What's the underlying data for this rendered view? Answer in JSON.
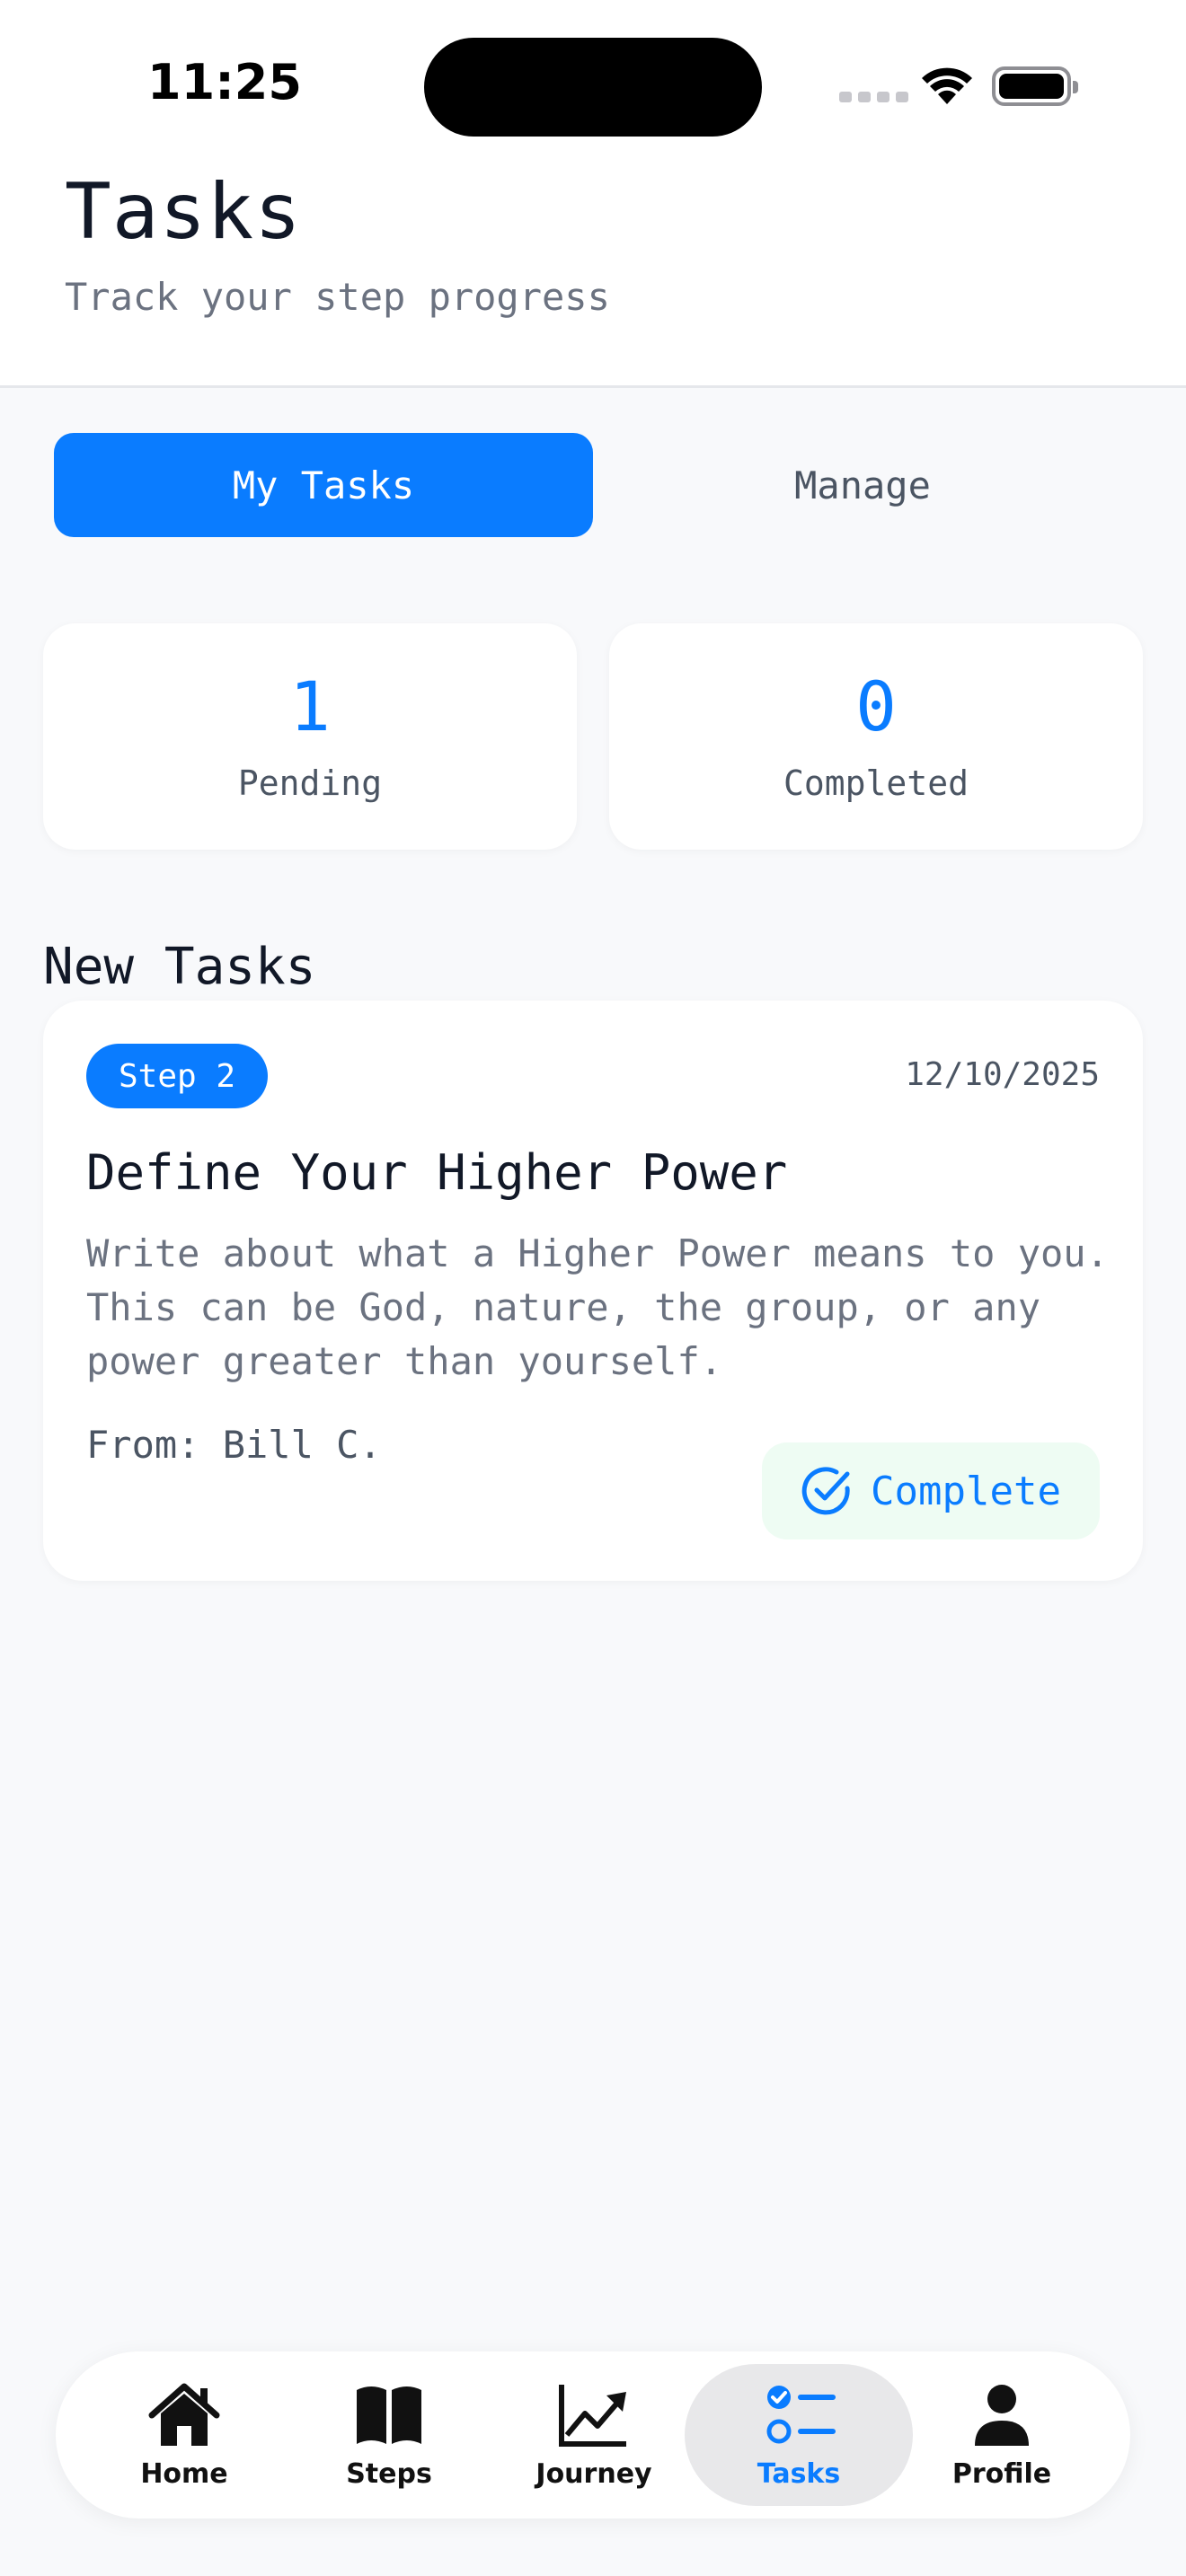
{
  "status_bar": {
    "time": "11:25"
  },
  "header": {
    "title": "Tasks",
    "subtitle": "Track your step progress"
  },
  "tabs": [
    {
      "label": "My Tasks",
      "active": true
    },
    {
      "label": "Manage",
      "active": false
    }
  ],
  "stats": {
    "pending": {
      "value": "1",
      "label": "Pending"
    },
    "completed": {
      "value": "0",
      "label": "Completed"
    }
  },
  "section": {
    "title": "New Tasks"
  },
  "task": {
    "badge": "Step 2",
    "date": "12/10/2025",
    "title": "Define Your Higher Power",
    "description": "Write about what a Higher Power means to you. This can be God, nature, the group, or any power greater than yourself.",
    "from": "From: Bill C.",
    "complete_label": "Complete",
    "complete_icon": "check-circle-icon"
  },
  "nav": [
    {
      "label": "Home",
      "icon": "home-icon"
    },
    {
      "label": "Steps",
      "icon": "book-icon"
    },
    {
      "label": "Journey",
      "icon": "chart-line-icon"
    },
    {
      "label": "Tasks",
      "icon": "checklist-icon",
      "active": true
    },
    {
      "label": "Profile",
      "icon": "person-icon"
    }
  ],
  "colors": {
    "accent": "#0a7cff",
    "background": "#f8f9fb",
    "complete_bg": "#eefcf3"
  }
}
